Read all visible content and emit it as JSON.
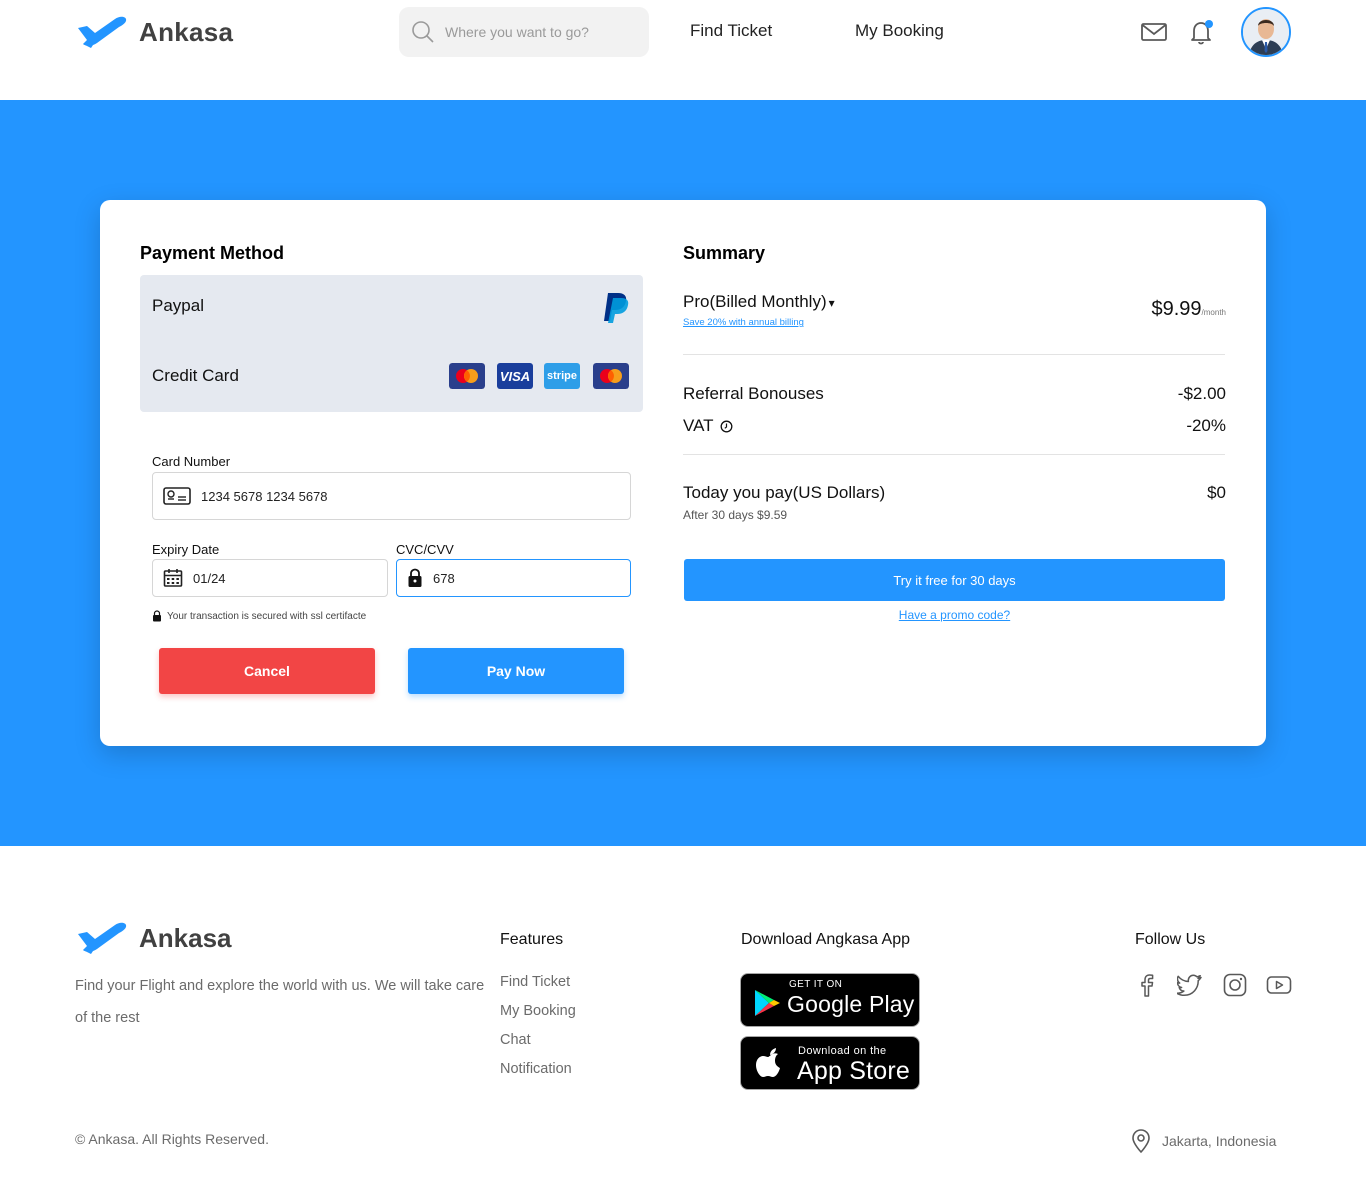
{
  "header": {
    "brand": "Ankasa",
    "search_placeholder": "Where you want to go?",
    "nav": [
      "Find Ticket",
      "My Booking"
    ]
  },
  "payment": {
    "title": "Payment Method",
    "methods": [
      "Paypal",
      "Credit Card"
    ],
    "card_logos": [
      "mastercard-icon",
      "visa-icon",
      "stripe-icon",
      "mastercard-icon"
    ],
    "visa_label": "VISA",
    "stripe_label": "stripe",
    "card_number_label": "Card Number",
    "card_number_value": "1234 5678 1234 5678",
    "expiry_label": "Expiry Date",
    "expiry_value": "01/24",
    "cvc_label": "CVC/CVV",
    "cvc_value": "678",
    "secure_note": "Your transaction is secured with ssl certifacte",
    "cancel_label": "Cancel",
    "pay_label": "Pay Now"
  },
  "summary": {
    "title": "Summary",
    "plan": "Pro(Billed Monthly)",
    "plan_caret": "▾",
    "save_link": "Save 20% with annual billing",
    "price": "$9.99",
    "price_unit": "/month",
    "referral_label": "Referral Bonouses",
    "referral_value": "-$2.00",
    "vat_label": "VAT",
    "vat_value": "-20%",
    "today_label": "Today you pay(US Dollars)",
    "today_value": "$0",
    "after_text": "After 30 days $9.59",
    "try_button": "Try it free for 30 days",
    "promo_link": "Have a promo code?"
  },
  "footer": {
    "brand": "Ankasa",
    "description": "Find your Flight and explore the world with us. We will take care of the rest",
    "features_title": "Features",
    "features": [
      "Find Ticket",
      "My Booking",
      "Chat",
      "Notification"
    ],
    "download_title": "Download Angkasa App",
    "google_small": "GET IT ON",
    "google_big": "Google Play",
    "apple_small": "Download on the",
    "apple_big": "App Store",
    "follow_title": "Follow Us",
    "socials": [
      "facebook-icon",
      "twitter-icon",
      "instagram-icon",
      "youtube-icon"
    ],
    "copyright": "© Ankasa. All Rights Reserved.",
    "location": "Jakarta, Indonesia"
  },
  "colors": {
    "primary": "#2395ff",
    "danger": "#f24545",
    "panel": "#e5e9f0"
  }
}
